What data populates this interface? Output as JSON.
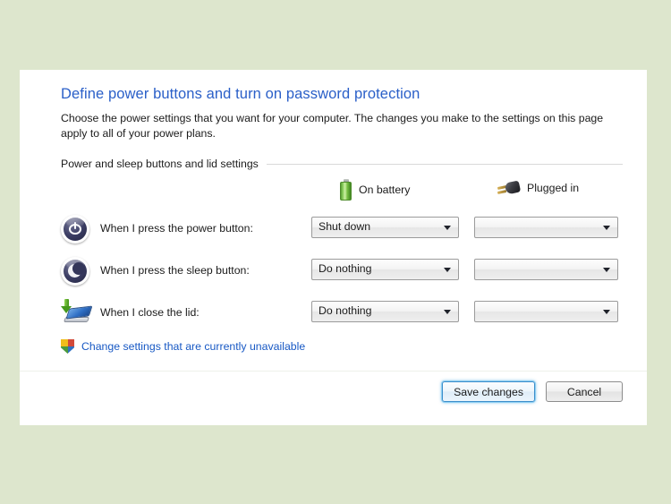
{
  "page": {
    "title": "Define power buttons and turn on password protection",
    "description": "Choose the power settings that you want for your computer. The changes you make to the settings on this page apply to all of your power plans."
  },
  "section": {
    "header": "Power and sleep buttons and lid settings",
    "columns": [
      {
        "label": "On battery",
        "icon": "battery-icon"
      },
      {
        "label": "Plugged in",
        "icon": "plug-icon"
      }
    ]
  },
  "settings": [
    {
      "icon": "power-button-icon",
      "label": "When I press the power button:",
      "on_battery": "Shut down",
      "plugged_in": ""
    },
    {
      "icon": "sleep-button-icon",
      "label": "When I press the sleep button:",
      "on_battery": "Do nothing",
      "plugged_in": ""
    },
    {
      "icon": "close-lid-icon",
      "label": "When I close the lid:",
      "on_battery": "Do nothing",
      "plugged_in": ""
    }
  ],
  "admin_link": {
    "icon": "uac-shield-icon",
    "text": "Change settings that are currently unavailable"
  },
  "footer": {
    "save_label": "Save changes",
    "cancel_label": "Cancel"
  },
  "colors": {
    "desktop_background": "#dde6cd",
    "panel_background": "#ffffff",
    "title_blue": "#2a5fc8",
    "link_blue": "#1758c4",
    "default_button_focus": "#3c8ecb"
  }
}
